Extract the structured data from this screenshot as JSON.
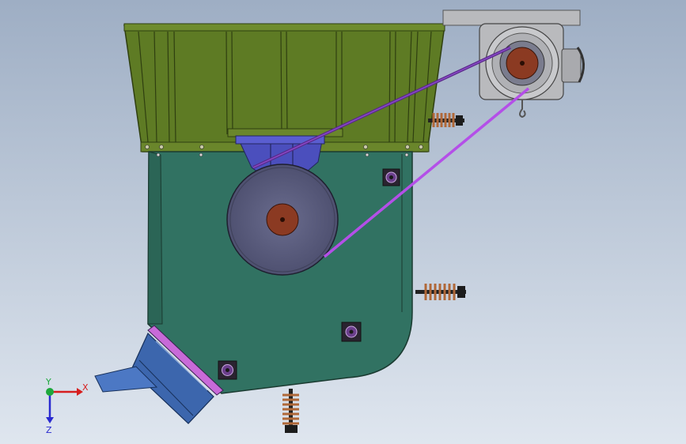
{
  "triad": {
    "x_label": "X",
    "y_label": "Y",
    "z_label": "Z"
  },
  "colors": {
    "background_top": "#9eaec4",
    "background_bottom": "#dfe6ef",
    "hopper_green": "#5e7b24",
    "housing_teal": "#317262",
    "pulley_gray": "#585a7c",
    "hub_brown": "#8b3a22",
    "belt_purple": "#b44fe8",
    "bracket_blue": "#4b4fbd",
    "chute_blue": "#3c66ad",
    "motor_gray": "#b9babd",
    "spring_copper": "#b06838"
  }
}
